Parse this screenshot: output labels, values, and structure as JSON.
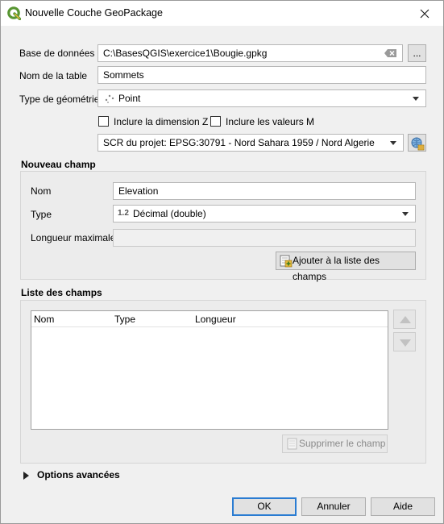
{
  "window": {
    "title": "Nouvelle Couche GeoPackage",
    "logo_icon": "qgis-logo-icon",
    "close_icon": "close-icon"
  },
  "form": {
    "database_label": "Base de données",
    "database_value": "C:\\BasesQGIS\\exercice1\\Bougie.gpkg",
    "browse_label": "...",
    "table_name_label": "Nom de la table",
    "table_name_value": "Sommets",
    "geometry_type_label": "Type de géométrie",
    "geometry_type_value": "Point",
    "include_z_label": "Inclure la dimension Z",
    "include_m_label": "Inclure les valeurs M",
    "crs_value": "SCR du projet: EPSG:30791 - Nord Sahara 1959 / Nord Algerie"
  },
  "new_field": {
    "title": "Nouveau champ",
    "name_label": "Nom",
    "name_value": "Elevation",
    "type_label": "Type",
    "type_badge": "1.2",
    "type_value": "Décimal (double)",
    "max_length_label": "Longueur maximale",
    "max_length_value": "",
    "add_button_label": "Ajouter à la liste des champs"
  },
  "field_list": {
    "title": "Liste des champs",
    "columns": [
      "Nom",
      "Type",
      "Longueur"
    ],
    "rows": [],
    "delete_button_label": "Supprimer le champ"
  },
  "advanced": {
    "label": "Options avancées"
  },
  "footer": {
    "ok_label": "OK",
    "cancel_label": "Annuler",
    "help_label": "Aide"
  },
  "colors": {
    "accent": "#2a7cd2",
    "qgis_green": "#589632"
  }
}
